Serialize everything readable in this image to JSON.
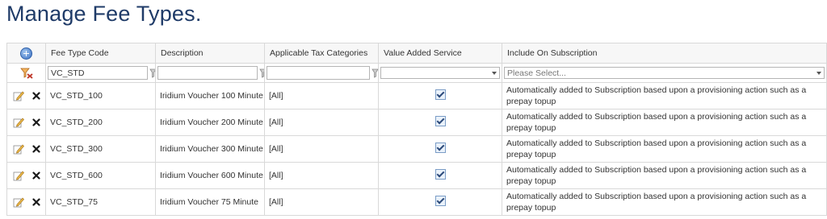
{
  "page": {
    "title": "Manage Fee Types."
  },
  "grid": {
    "columns": [
      {
        "key": "code",
        "label": "Fee Type Code"
      },
      {
        "key": "description",
        "label": "Description"
      },
      {
        "key": "tax",
        "label": "Applicable Tax Categories"
      },
      {
        "key": "vas",
        "label": "Value Added Service"
      },
      {
        "key": "subscription",
        "label": "Include On Subscription"
      }
    ],
    "filters": {
      "code": "VC_STD",
      "description": "",
      "tax": "",
      "vas": "",
      "subscription_placeholder": "Please Select..."
    },
    "rows": [
      {
        "code": "VC_STD_100",
        "description": "Iridium Voucher 100 Minute",
        "tax": "[All]",
        "vas": true,
        "subscription": "Automatically added to Subscription based upon a provisioning action such as a prepay topup"
      },
      {
        "code": "VC_STD_200",
        "description": "Iridium Voucher 200 Minute",
        "tax": "[All]",
        "vas": true,
        "subscription": "Automatically added to Subscription based upon a provisioning action such as a prepay topup"
      },
      {
        "code": "VC_STD_300",
        "description": "Iridium Voucher 300 Minute",
        "tax": "[All]",
        "vas": true,
        "subscription": "Automatically added to Subscription based upon a provisioning action such as a prepay topup"
      },
      {
        "code": "VC_STD_600",
        "description": "Iridium Voucher 600 Minute",
        "tax": "[All]",
        "vas": true,
        "subscription": "Automatically added to Subscription based upon a provisioning action such as a prepay topup"
      },
      {
        "code": "VC_STD_75",
        "description": "Iridium Voucher 75 Minute",
        "tax": "[All]",
        "vas": true,
        "subscription": "Automatically added to Subscription based upon a provisioning action such as a prepay topup"
      }
    ]
  },
  "icons": {
    "add": "add-circle-icon",
    "clear_filter": "clear-filter-icon",
    "filter": "filter-icon",
    "edit": "edit-pencil-icon",
    "delete": "delete-x-icon",
    "checkbox": "checkbox-checked-icon",
    "dropdown": "chevron-down-icon"
  },
  "colors": {
    "title": "#1f3b68",
    "accent": "#3d73c4"
  }
}
